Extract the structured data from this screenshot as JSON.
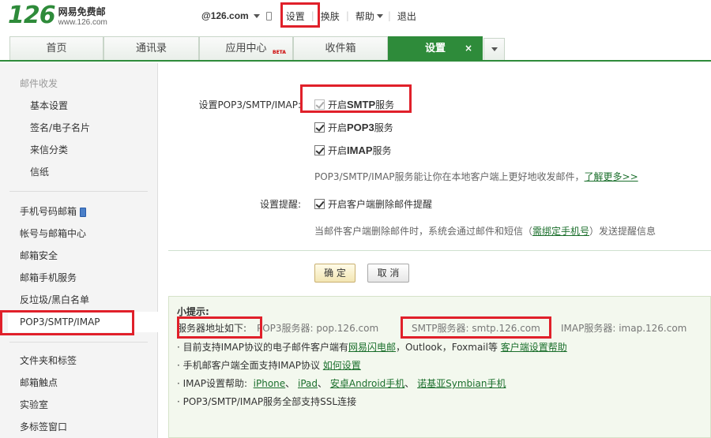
{
  "header": {
    "logo_number": "126",
    "logo_name": "网易免费邮",
    "logo_url": "www.126.com",
    "account": "@126.com",
    "menu": {
      "settings": "设置",
      "skin": "换肤",
      "help": "帮助",
      "logout": "退出"
    }
  },
  "tabs": [
    {
      "label": "首页"
    },
    {
      "label": "通讯录"
    },
    {
      "label": "应用中心",
      "badge": "BETA"
    },
    {
      "label": "收件箱"
    },
    {
      "label": "设置",
      "active": true,
      "close": "×"
    }
  ],
  "sidebar": {
    "group1_head": "邮件收发",
    "group1": [
      "基本设置",
      "签名/电子名片",
      "来信分类",
      "信纸"
    ],
    "group2": [
      "手机号码邮箱",
      "帐号与邮箱中心",
      "邮箱安全",
      "邮箱手机服务",
      "反垃圾/黑白名单",
      "POP3/SMTP/IMAP"
    ],
    "group3": [
      "文件夹和标签",
      "邮箱触点",
      "实验室",
      "多标签窗口"
    ]
  },
  "main": {
    "pop_label": "设置POP3/SMTP/IMAP:",
    "smtp_prefix": "开启",
    "smtp_bold": "SMTP",
    "smtp_suffix": "服务",
    "pop3_prefix": "开启",
    "pop3_bold": "POP3",
    "pop3_suffix": "服务",
    "imap_prefix": "开启",
    "imap_bold": "IMAP",
    "imap_suffix": "服务",
    "pop_hint": "POP3/SMTP/IMAP服务能让你在本地客户端上更好地收发邮件，",
    "learn_more": "了解更多>>",
    "remind_label": "设置提醒:",
    "remind_option": "开启客户端删除邮件提醒",
    "remind_hint_pre": "当邮件客户端删除邮件时，系统会通过邮件和短信（",
    "remind_hint_link": "需绑定手机号",
    "remind_hint_post": "）发送提醒信息",
    "ok": "确 定",
    "cancel": "取 消"
  },
  "tips": {
    "title": "小提示:",
    "server_label": "服务器地址如下:",
    "pop3_server": "POP3服务器: pop.126.com",
    "smtp_server": "SMTP服务器: smtp.126.com",
    "imap_server": "IMAP服务器: imap.126.com",
    "line1_pre": "· 目前支持IMAP协议的电子邮件客户端有",
    "line1_link1": "网易闪电邮",
    "line1_mid": "，Outlook，Foxmail等",
    "line1_link2": "客户端设置帮助",
    "line2_pre": "· 手机邮客户端全面支持IMAP协议",
    "line2_link": "如何设置",
    "line3_pre": "· IMAP设置帮助:",
    "line3_iphone": "iPhone",
    "line3_ipad": "iPad",
    "line3_android": "安卓Android手机",
    "line3_symbian": "诺基亚Symbian手机",
    "line3_sep": "、",
    "line4": "· POP3/SMTP/IMAP服务全部支持SSL连接"
  },
  "colors": {
    "brand_green": "#2e8b3a",
    "highlight_red": "#e0202a",
    "link_green": "#1b6f2c"
  }
}
